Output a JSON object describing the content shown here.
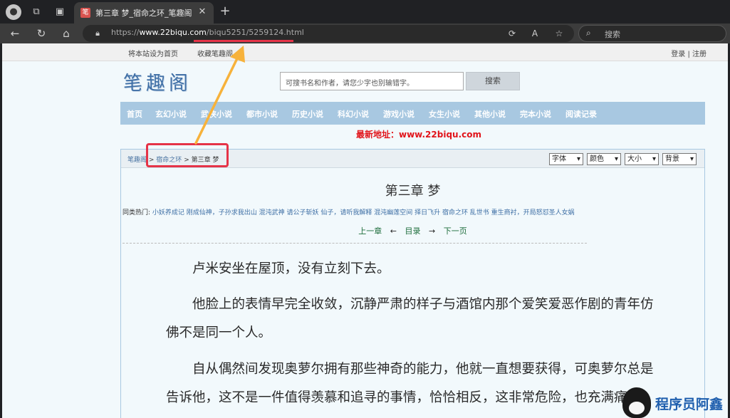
{
  "browser": {
    "tab_title": "第三章 梦_宿命之环_笔趣阁",
    "url_scheme": "https://",
    "url_host": "www.22biqu.com",
    "url_path": "/biqu5251/5259124.html",
    "search_placeholder": "搜索"
  },
  "site": {
    "top_links": [
      "将本站设为首页",
      "收藏笔趣阁"
    ],
    "login_text": "登录 | 注册",
    "logo": "笔趣阁",
    "search_placeholder": "可搜书名和作者，请您少字也别输错字。",
    "search_button": "搜索",
    "menu": [
      "首页",
      "玄幻小说",
      "武侠小说",
      "都市小说",
      "历史小说",
      "科幻小说",
      "游戏小说",
      "女生小说",
      "其他小说",
      "完本小说",
      "阅读记录"
    ],
    "new_address": "最新地址：www.22biqu.com"
  },
  "reader": {
    "breadcrumb_home": "笔趣阁",
    "breadcrumb_book": "宿命之环",
    "breadcrumb_chapter": "第三章 梦",
    "selects": [
      "字体",
      "颜色",
      "大小",
      "背景"
    ],
    "chapter_title": "第三章 梦",
    "hot_label": "同类热门:",
    "hot_items": "小妖养成记 刚成仙神，子孙求我出山 混沌武神 请公子斩妖 仙子，请听我解释 混沌幽莲空间 择日飞升 宿命之环 乱世书 重生商衬，开局怒怼圣人女娲",
    "pager_prev": "上一章",
    "pager_arrow_left": "←",
    "pager_toc": "目录",
    "pager_arrow_right": "→",
    "pager_next": "下一页",
    "paragraphs": [
      "卢米安坐在屋顶，没有立刻下去。",
      "他脸上的表情早完全收敛，沉静严肃的样子与酒馆内那个爱笑爱恶作剧的青年仿佛不是同一个人。",
      "自从偶然间发现奥萝尔拥有那些神奇的能力，他就一直想要获得，可奥萝尔总是告诉他，这不是一件值得羡慕和追寻的事情，恰恰相反，这非常危险，也充满痛"
    ]
  },
  "watermark": "程序员阿鑫",
  "colors": {
    "menu_bg": "#a8c8e1",
    "highlight": "#e53347",
    "arrow": "#f7b23b",
    "new_address": "#e1141a"
  }
}
